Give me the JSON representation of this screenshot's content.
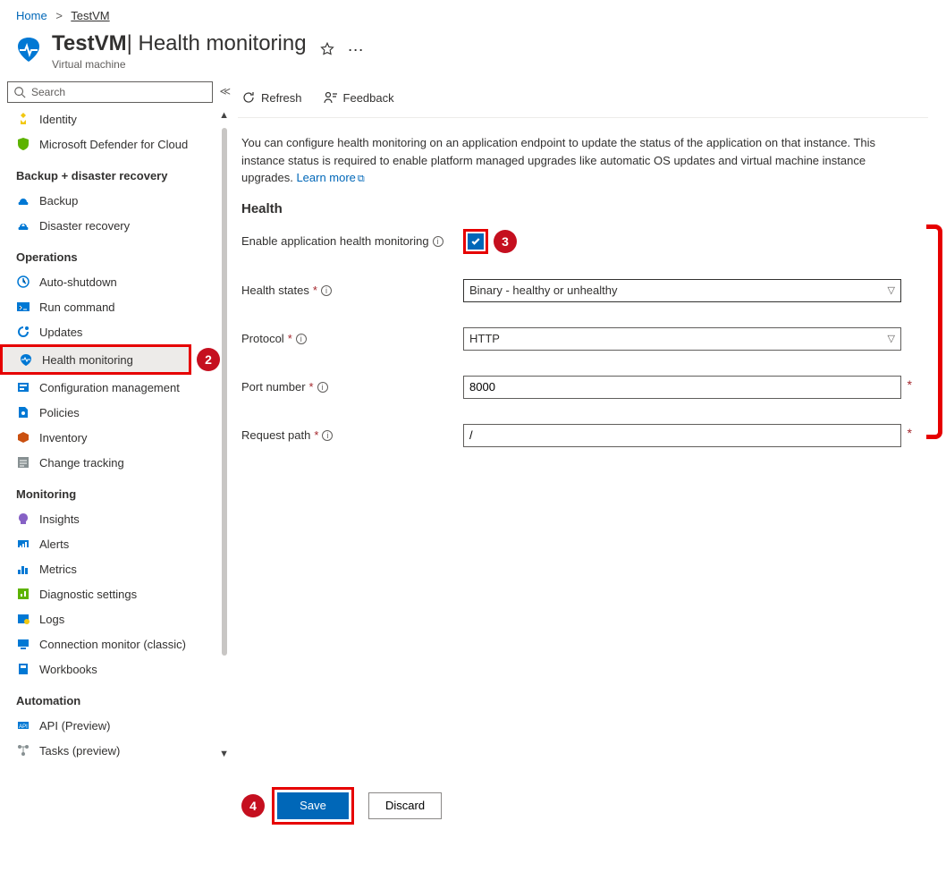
{
  "breadcrumb": {
    "home": "Home",
    "current": "TestVM"
  },
  "header": {
    "title_main": "TestVM",
    "title_light": " | Health monitoring",
    "subtitle": "Virtual machine"
  },
  "sidebar": {
    "search_placeholder": "Search",
    "groups": [
      {
        "title": null,
        "items": [
          {
            "label": "Identity",
            "icon": "identity"
          },
          {
            "label": "Microsoft Defender for Cloud",
            "icon": "defender"
          }
        ]
      },
      {
        "title": "Backup + disaster recovery",
        "items": [
          {
            "label": "Backup",
            "icon": "backup"
          },
          {
            "label": "Disaster recovery",
            "icon": "recovery"
          }
        ]
      },
      {
        "title": "Operations",
        "items": [
          {
            "label": "Auto-shutdown",
            "icon": "autoshutdown"
          },
          {
            "label": "Run command",
            "icon": "runcommand"
          },
          {
            "label": "Updates",
            "icon": "updates"
          },
          {
            "label": "Health monitoring",
            "icon": "health",
            "selected": true,
            "callout": "2"
          },
          {
            "label": "Configuration management",
            "icon": "config"
          },
          {
            "label": "Policies",
            "icon": "policies"
          },
          {
            "label": "Inventory",
            "icon": "inventory"
          },
          {
            "label": "Change tracking",
            "icon": "changetracking"
          }
        ]
      },
      {
        "title": "Monitoring",
        "items": [
          {
            "label": "Insights",
            "icon": "insights"
          },
          {
            "label": "Alerts",
            "icon": "alerts"
          },
          {
            "label": "Metrics",
            "icon": "metrics"
          },
          {
            "label": "Diagnostic settings",
            "icon": "diagnostic"
          },
          {
            "label": "Logs",
            "icon": "logs"
          },
          {
            "label": "Connection monitor (classic)",
            "icon": "connmonitor"
          },
          {
            "label": "Workbooks",
            "icon": "workbooks"
          }
        ]
      },
      {
        "title": "Automation",
        "items": [
          {
            "label": "API (Preview)",
            "icon": "api"
          },
          {
            "label": "Tasks (preview)",
            "icon": "tasks"
          }
        ]
      }
    ]
  },
  "toolbar": {
    "refresh": "Refresh",
    "feedback": "Feedback"
  },
  "description": {
    "text": "You can configure health monitoring on an application endpoint to update the status of the application on that instance. This instance status is required to enable platform managed upgrades like automatic OS updates and virtual machine instance upgrades. ",
    "link": "Learn more"
  },
  "form": {
    "section_title": "Health",
    "enable_label": "Enable application health monitoring",
    "enable_checked": true,
    "enable_callout": "3",
    "health_states": {
      "label": "Health states",
      "value": "Binary - healthy or unhealthy"
    },
    "protocol": {
      "label": "Protocol",
      "value": "HTTP"
    },
    "port": {
      "label": "Port number",
      "value": "8000"
    },
    "path": {
      "label": "Request path",
      "value": "/"
    }
  },
  "footer": {
    "save": "Save",
    "discard": "Discard",
    "save_callout": "4"
  }
}
